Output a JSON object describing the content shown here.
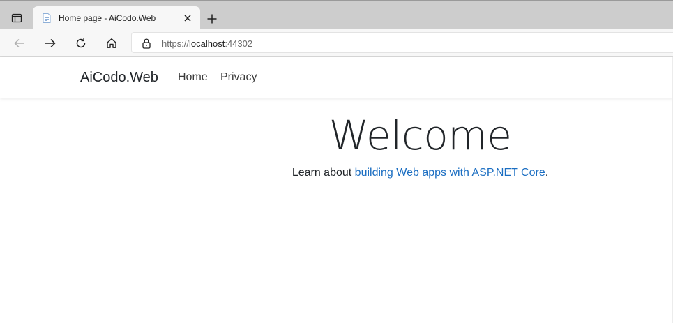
{
  "browser": {
    "tab": {
      "title": "Home page - AiCodo.Web",
      "favicon": "document-icon"
    },
    "address_bar": {
      "scheme": "https://",
      "host": "localhost",
      "port": ":44302"
    },
    "icons": {
      "tab_actions": "tab-actions-icon",
      "close": "close-icon",
      "new_tab": "plus-icon",
      "back": "back-arrow-icon",
      "forward": "forward-arrow-icon",
      "refresh": "refresh-icon",
      "home": "home-icon",
      "lock": "lock-icon"
    }
  },
  "site": {
    "brand": "AiCodo.Web",
    "nav": {
      "home": "Home",
      "privacy": "Privacy"
    },
    "main": {
      "heading": "Welcome",
      "learn_prefix": "Learn about ",
      "learn_link": "building Web apps with ASP.NET Core",
      "learn_suffix": "."
    }
  },
  "colors": {
    "link": "#1b6ec2",
    "text": "#212529",
    "tabbar": "#cdcdcd",
    "toolbar": "#f7f7f7"
  }
}
